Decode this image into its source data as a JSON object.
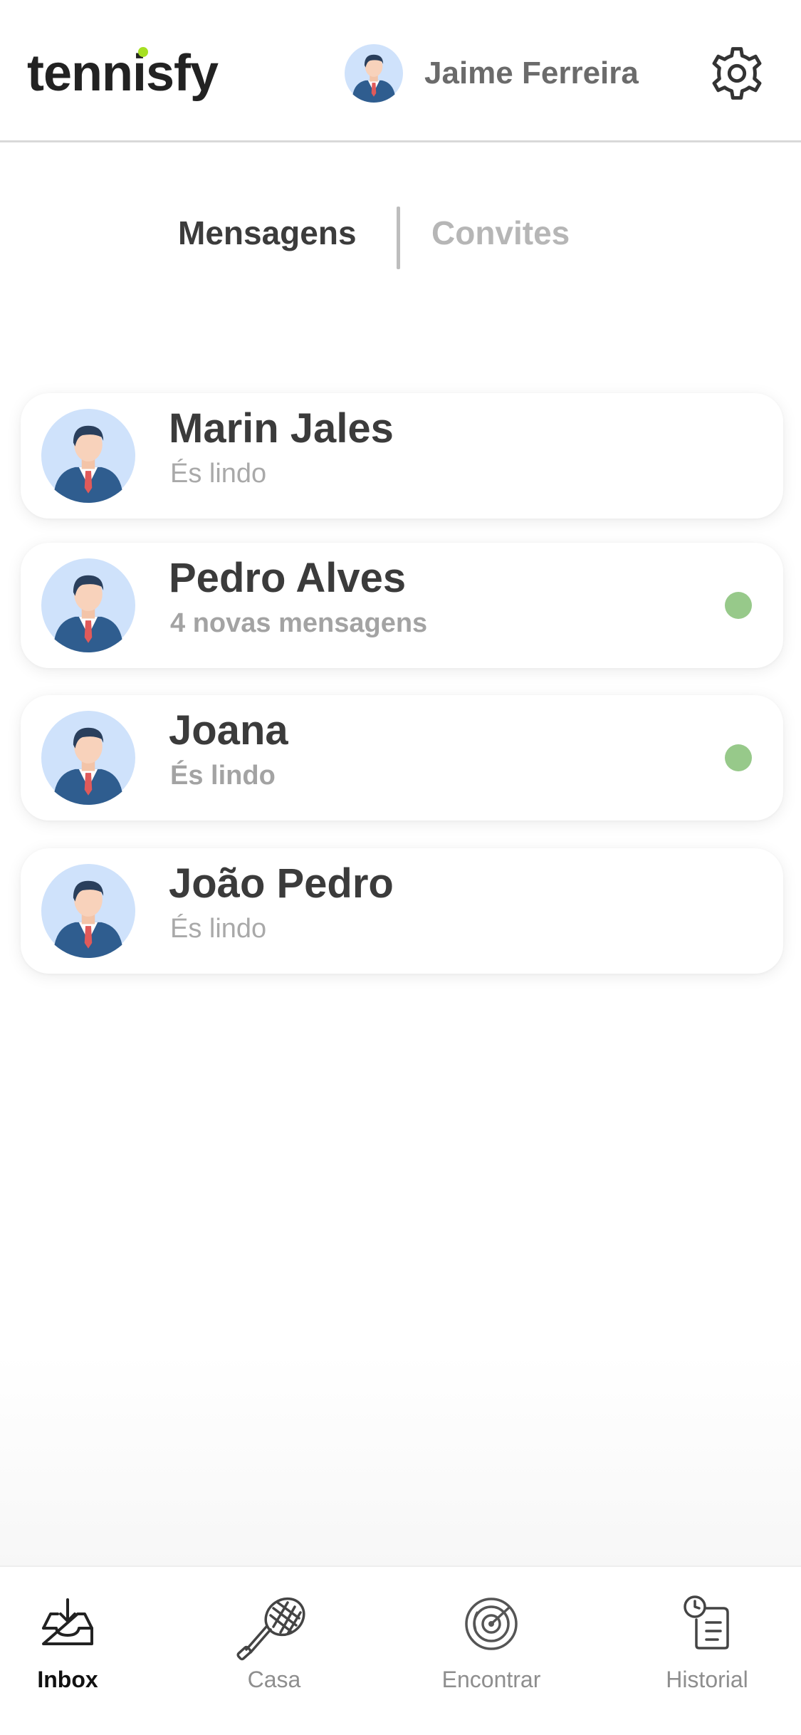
{
  "header": {
    "logo": "tennisfy",
    "user_name": "Jaime Ferreira",
    "avatar_icon": "user-avatar-icon",
    "settings_icon": "gear-icon"
  },
  "tabs": [
    {
      "label": "Mensagens",
      "active": true
    },
    {
      "label": "Convites",
      "active": false
    }
  ],
  "conversations": [
    {
      "name": "Marin Jales",
      "preview": "És lindo",
      "unread": false
    },
    {
      "name": "Pedro Alves",
      "preview": "4 novas mensagens",
      "unread": true
    },
    {
      "name": "Joana",
      "preview": "És lindo",
      "unread": true
    },
    {
      "name": "João Pedro",
      "preview": "És lindo",
      "unread": false
    }
  ],
  "bottom_nav": [
    {
      "label": "Inbox",
      "icon": "inbox-icon",
      "active": true
    },
    {
      "label": "Casa",
      "icon": "tennis-racket-icon",
      "active": false
    },
    {
      "label": "Encontrar",
      "icon": "radar-icon",
      "active": false
    },
    {
      "label": "Historial",
      "icon": "history-icon",
      "active": false
    }
  ],
  "colors": {
    "brand_accent": "#a6e022",
    "unread_dot": "#97c98a",
    "text_dark": "#3b3b3b",
    "text_muted": "#a9a9a9"
  }
}
